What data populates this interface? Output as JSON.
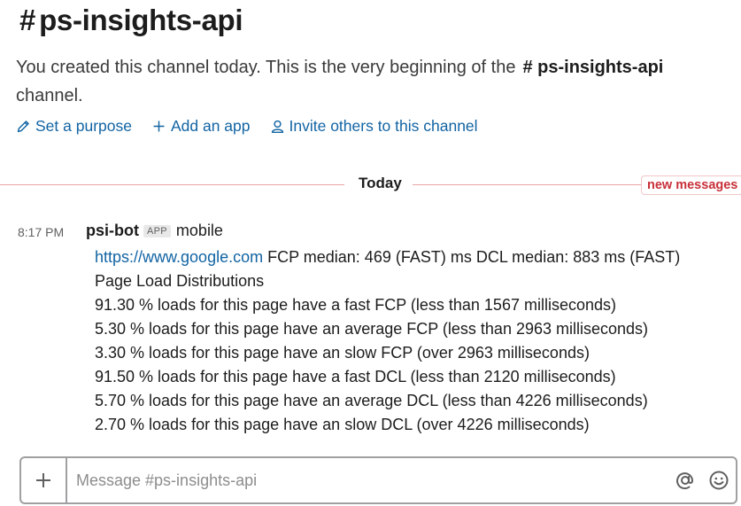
{
  "channel": {
    "hash": "#",
    "name": "ps-insights-api"
  },
  "intro": {
    "text_before": "You created this channel today. This is the very beginning of the",
    "channel_ref": "# ps-insights-api",
    "text_after": "channel."
  },
  "actions": {
    "purpose_label": "Set a purpose",
    "add_app_label": "Add an app",
    "invite_label": "Invite others to this channel"
  },
  "divider": {
    "label": "Today",
    "new_messages_label": "new messages",
    "accent_color": "#e8a5a5"
  },
  "message": {
    "time": "8:17 PM",
    "sender": "psi-bot",
    "badge": "APP",
    "platform": "mobile",
    "link_text": "https://www.google.com",
    "link_suffix": " FCP median: 469 (FAST) ms DCL median: 883 ms (FAST)",
    "lines": [
      "Page Load Distributions",
      "91.30 % loads for this page have a fast FCP (less than 1567 milliseconds)",
      "5.30 % loads for this page have an average FCP (less than 2963 milliseconds)",
      "3.30 % loads for this page have an slow FCP (over 2963 milliseconds)",
      "91.50 % loads for this page have a fast DCL (less than 2120 milliseconds)",
      "5.70 % loads for this page have an average DCL (less than 4226 milliseconds)",
      "2.70 % loads for this page have an slow DCL (over 4226 milliseconds)"
    ]
  },
  "composer": {
    "placeholder": "Message #ps-insights-api",
    "plus_icon": "plus-icon",
    "mention_icon": "at-sign-icon",
    "emoji_icon": "smiley-icon"
  },
  "colors": {
    "link": "#1264a3",
    "new_messages": "#c8303a"
  }
}
